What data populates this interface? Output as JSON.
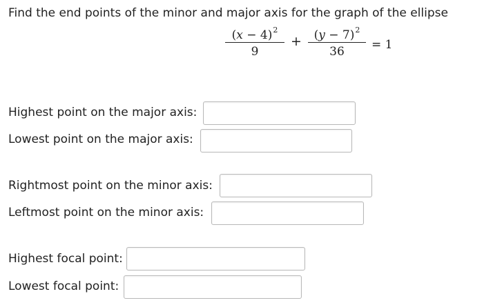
{
  "question": {
    "prompt": "Find the end points of the minor and major axis for the graph of the ellipse",
    "equation": {
      "term1_numerator_open": "(",
      "term1_variable": "x",
      "term1_numerator_rest": " − 4)",
      "term1_exponent": "2",
      "term1_denominator": "9",
      "plus": "+",
      "term2_numerator_open": "(",
      "term2_variable": "y",
      "term2_numerator_rest": " − 7)",
      "term2_exponent": "2",
      "term2_denominator": "36",
      "equals_text": "= 1"
    }
  },
  "fields": {
    "major_highest": {
      "label": "Highest point on the major axis:",
      "value": ""
    },
    "major_lowest": {
      "label": "Lowest point on the major axis:",
      "value": ""
    },
    "minor_rightmost": {
      "label": "Rightmost point on the minor axis:",
      "value": ""
    },
    "minor_leftmost": {
      "label": "Leftmost point on the minor axis:",
      "value": ""
    },
    "focal_highest": {
      "label": "Highest focal point:",
      "value": ""
    },
    "focal_lowest": {
      "label": "Lowest focal point:",
      "value": ""
    }
  }
}
